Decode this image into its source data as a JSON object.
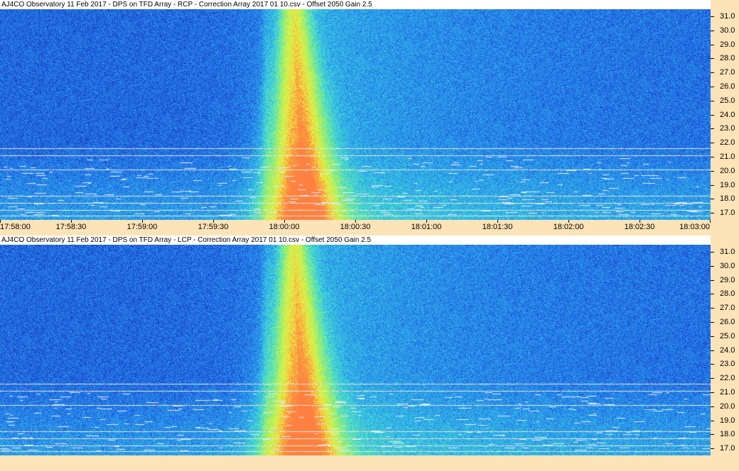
{
  "chart_data": [
    {
      "type": "heatmap",
      "title": "AJ4CO Observatory 11 Feb 2017  -  DPS on TFD Array  -  RCP  -  Correction Array 2017 01 10.csv  -  Offset 2050  Gain 2.5",
      "polarization": "RCP",
      "x_ticks": [
        "17:58:00",
        "17:58:30",
        "17:59:00",
        "17:59:30",
        "18:00:00",
        "18:00:30",
        "18:01:00",
        "18:01:30",
        "18:02:00",
        "18:02:30",
        "18:03:00"
      ],
      "y_ticks": [
        "31.0",
        "30.0",
        "29.0",
        "28.0",
        "27.0",
        "26.0",
        "25.0",
        "24.0",
        "23.0",
        "22.0",
        "21.0",
        "20.0",
        "19.0",
        "18.0",
        "17.0"
      ],
      "xlim": [
        "17:58:00",
        "18:03:00"
      ],
      "ylim": [
        16.5,
        31.5
      ],
      "burst_peak_time": "18:00:05",
      "interference_lines_mhz": [
        21.6,
        21.1,
        20.1,
        18.2,
        17.7,
        17.2,
        16.8
      ],
      "colormap": [
        "#0a1a7a",
        "#1e4fd8",
        "#2a9df0",
        "#45e0d0",
        "#a8f060",
        "#f0f040",
        "#ff8040"
      ]
    },
    {
      "type": "heatmap",
      "title": "AJ4CO Observatory 11 Feb 2017  -  DPS on TFD Array  -  LCP  -  Correction Array 2017 01 10.csv  -  Offset 2050  Gain 2.5",
      "polarization": "LCP",
      "y_ticks": [
        "31.0",
        "30.0",
        "29.0",
        "28.0",
        "27.0",
        "26.0",
        "25.0",
        "24.0",
        "23.0",
        "22.0",
        "21.0",
        "20.0",
        "19.0",
        "18.0",
        "17.0"
      ],
      "xlim": [
        "17:58:00",
        "18:03:00"
      ],
      "ylim": [
        16.5,
        31.5
      ],
      "burst_peak_time": "18:00:05",
      "interference_lines_mhz": [
        21.6,
        21.1,
        20.1,
        18.2,
        17.7,
        17.2,
        16.8
      ],
      "colormap": [
        "#0a1a7a",
        "#1e4fd8",
        "#2a9df0",
        "#45e0d0",
        "#a8f060",
        "#f0f040",
        "#ff8040"
      ]
    }
  ]
}
